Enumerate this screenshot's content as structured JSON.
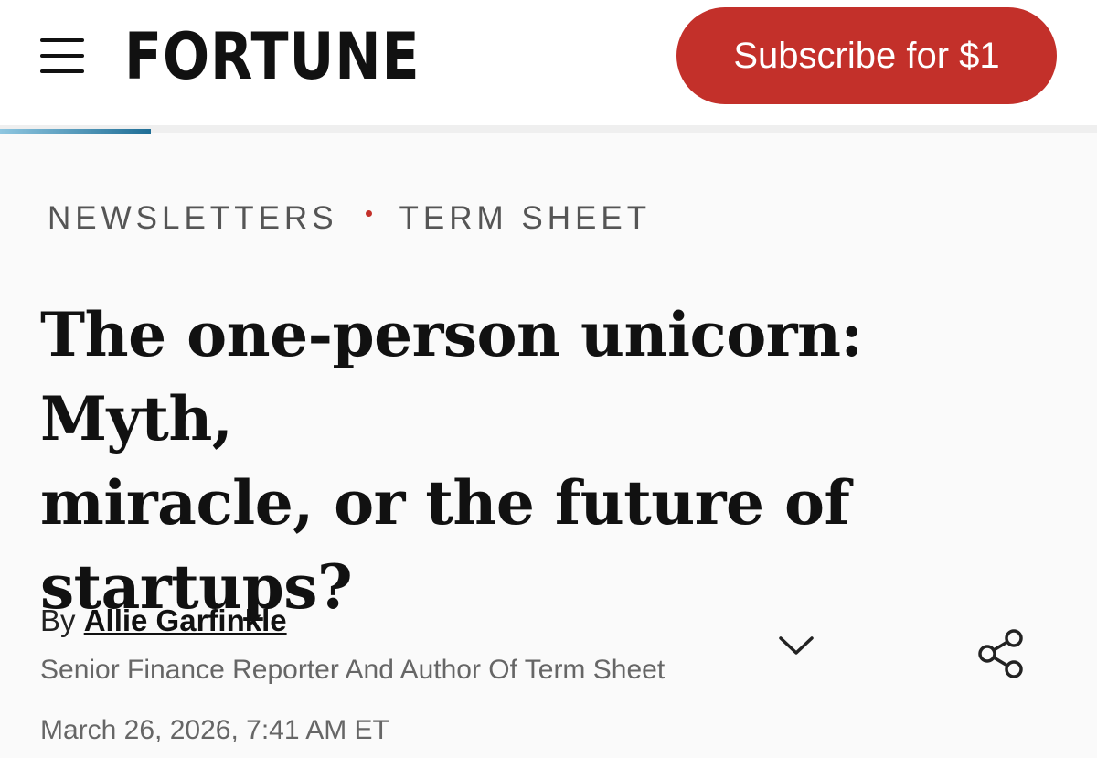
{
  "header": {
    "logo_text": "FORTUNE",
    "subscribe_label": "Subscribe for $1",
    "brand_red": "#c3302a",
    "menu_icon": "hamburger-menu-icon"
  },
  "breadcrumb": {
    "items": [
      {
        "label": "NEWSLETTERS"
      },
      {
        "label": "TERM SHEET"
      }
    ]
  },
  "article": {
    "headline_lines": [
      "The one-person unicorn: Myth,",
      "miracle, or the future of",
      "startups?"
    ],
    "byline_prefix": "By",
    "author_name": "Allie Garfinkle",
    "author_title": "Senior Finance Reporter And Author Of Term Sheet",
    "date": "March 26, 2026, 7:41 AM ET",
    "expand_icon": "chevron-down-icon",
    "share_icon": "share-icon"
  }
}
